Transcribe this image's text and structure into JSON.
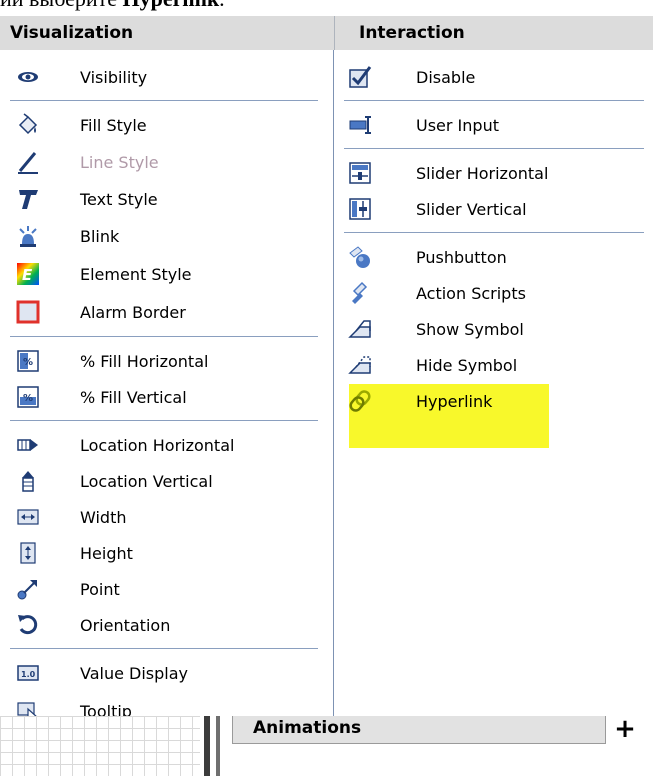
{
  "top_text": {
    "prefix": "ии выберите ",
    "bold": "Hyperlink",
    "suffix": "."
  },
  "visualization": {
    "header": "Visualization",
    "items": [
      {
        "label": "Visibility",
        "icon": "eye-icon"
      },
      {
        "label": "Fill Style",
        "icon": "paint-bucket-icon"
      },
      {
        "label": "Line Style",
        "icon": "pen-line-icon",
        "disabled": true
      },
      {
        "label": "Text Style",
        "icon": "text-t-icon"
      },
      {
        "label": "Blink",
        "icon": "blink-lamp-icon"
      },
      {
        "label": "Element Style",
        "icon": "element-style-icon"
      },
      {
        "label": "Alarm Border",
        "icon": "alarm-border-icon"
      },
      {
        "label": "% Fill Horizontal",
        "icon": "percent-fill-horizontal-icon"
      },
      {
        "label": "% Fill Vertical",
        "icon": "percent-fill-vertical-icon"
      },
      {
        "label": "Location Horizontal",
        "icon": "location-horizontal-icon"
      },
      {
        "label": "Location Vertical",
        "icon": "location-vertical-icon"
      },
      {
        "label": "Width",
        "icon": "width-icon"
      },
      {
        "label": "Height",
        "icon": "height-icon"
      },
      {
        "label": "Point",
        "icon": "point-icon"
      },
      {
        "label": "Orientation",
        "icon": "orientation-icon"
      },
      {
        "label": "Value Display",
        "icon": "value-display-icon"
      },
      {
        "label": "Tooltip",
        "icon": "tooltip-icon"
      }
    ]
  },
  "interaction": {
    "header": "Interaction",
    "items": [
      {
        "label": "Disable",
        "icon": "disable-check-icon"
      },
      {
        "label": "User Input",
        "icon": "user-input-icon"
      },
      {
        "label": "Slider Horizontal",
        "icon": "slider-horizontal-icon"
      },
      {
        "label": "Slider Vertical",
        "icon": "slider-vertical-icon"
      },
      {
        "label": "Pushbutton",
        "icon": "pushbutton-icon"
      },
      {
        "label": "Action Scripts",
        "icon": "action-scripts-icon"
      },
      {
        "label": "Show Symbol",
        "icon": "show-symbol-icon"
      },
      {
        "label": "Hide Symbol",
        "icon": "hide-symbol-icon"
      },
      {
        "label": "Hyperlink",
        "icon": "hyperlink-chain-icon",
        "highlighted": true
      }
    ]
  },
  "bottom": {
    "tab_label": "Animations",
    "plus": "+"
  },
  "colors": {
    "highlight": "#f8f82b",
    "header_bg": "#dcdcdc",
    "separator": "#8a9fbf"
  }
}
